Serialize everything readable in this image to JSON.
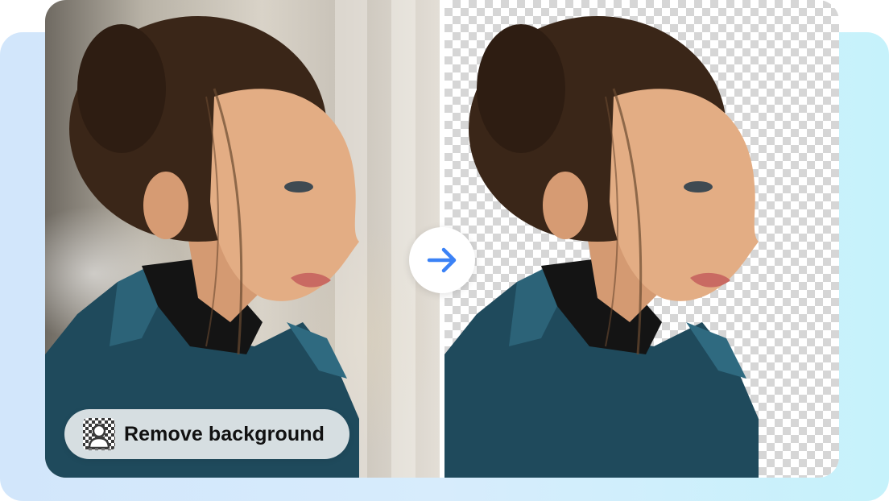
{
  "action": {
    "label": "Remove background",
    "icon": "checkerboard-person-icon"
  },
  "transition_icon": "arrow-right-icon",
  "images": {
    "before": "original-portrait-photo",
    "after": "background-removed-portrait"
  },
  "colors": {
    "accent": "#3b82f6",
    "backdrop_start": "#d2e6fb",
    "backdrop_end": "#c6f2fb",
    "checker": "#d6d6d6"
  }
}
